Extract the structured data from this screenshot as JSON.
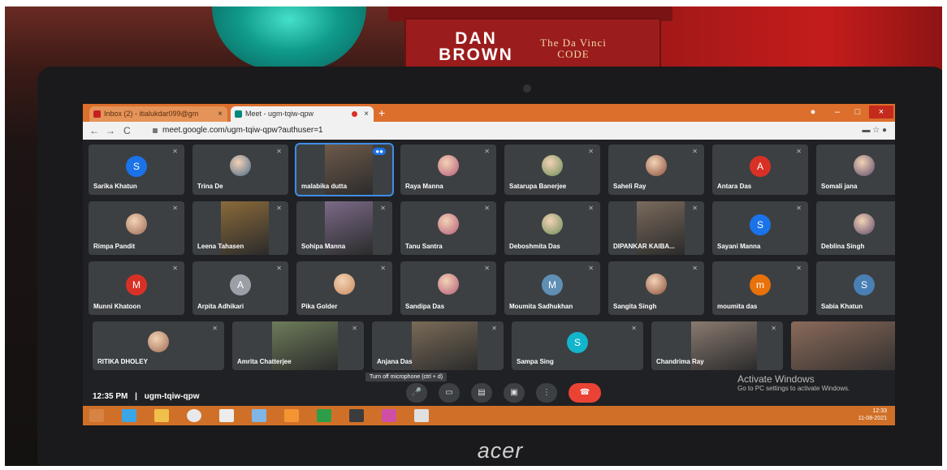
{
  "book": {
    "author": "DAN BROWN",
    "title": "The Da Vinci CODE"
  },
  "laptop": {
    "brand": "acer"
  },
  "browser": {
    "tabs": [
      {
        "label": "Inbox (2) - itialukdar099@gm"
      },
      {
        "label": "Meet - ugm-tqiw-qpw"
      }
    ],
    "new_tab": "+",
    "url": "meet.google.com/ugm-tqiw-qpw?authuser=1",
    "nav_back": "←",
    "nav_forward": "→",
    "nav_reload": "C"
  },
  "colors": {
    "meet_bg": "#202124",
    "tile_bg": "#3c4043",
    "active_border": "#3f8ee8",
    "end_call": "#ea4335",
    "taskbar": "#d07028"
  },
  "participants": [
    {
      "name": "Sarika Khatun",
      "avatar": "S",
      "avatar_color": "#1a73e8"
    },
    {
      "name": "Trina De"
    },
    {
      "name": "malabika dutta"
    },
    {
      "name": "Raya Manna"
    },
    {
      "name": "Satarupa Banerjee"
    },
    {
      "name": "Saheli Ray"
    },
    {
      "name": "Antara Das",
      "avatar": "A",
      "avatar_color": "#d93025"
    },
    {
      "name": "Somali jana"
    },
    {
      "name": "Rimpa Pandit"
    },
    {
      "name": "Leena Tahasen"
    },
    {
      "name": "Sohipa Manna"
    },
    {
      "name": "Tanu Santra"
    },
    {
      "name": "Deboshmita Das"
    },
    {
      "name": "DIPANKAR KAIBA..."
    },
    {
      "name": "Sayani Manna",
      "avatar": "S",
      "avatar_color": "#1a73e8"
    },
    {
      "name": "Deblina Singh"
    },
    {
      "name": "Munni Khatoon",
      "avatar": "M",
      "avatar_color": "#d93025"
    },
    {
      "name": "Arpita Adhikari",
      "avatar": "A",
      "avatar_color": "#9aa0a6"
    },
    {
      "name": "Pika Golder"
    },
    {
      "name": "Sandipa Das"
    },
    {
      "name": "Moumita Sadhukhan",
      "avatar": "M",
      "avatar_color": "#5f8fb5"
    },
    {
      "name": "Sangita Singh"
    },
    {
      "name": "moumita das",
      "avatar": "m",
      "avatar_color": "#e8710a"
    },
    {
      "name": "Sabia Khatun",
      "avatar": "S",
      "avatar_color": "#4a7fb5"
    },
    {
      "name": "RITIKA DHOLEY"
    },
    {
      "name": "Amrita Chatterjee"
    },
    {
      "name": "Anjana Das"
    },
    {
      "name": "Sampa Sing",
      "avatar": "S",
      "avatar_color": "#12b5cb"
    },
    {
      "name": "Chandrima Ray"
    },
    {
      "name": ""
    }
  ],
  "meeting": {
    "time": "12:35 PM",
    "separator": "|",
    "code": "ugm-tqiw-qpw"
  },
  "tooltip": "Turn off microphone (ctrl + d)",
  "windows": {
    "activate_title": "Activate Windows",
    "activate_sub": "Go to PC settings to activate Windows.",
    "tray_time": "12:33",
    "tray_date": "11-08-2021"
  }
}
